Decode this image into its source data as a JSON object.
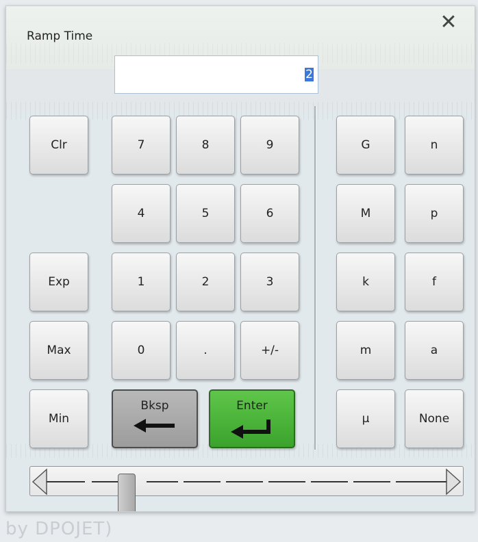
{
  "dialog": {
    "title": "Ramp Time",
    "close_glyph": "✕",
    "value": "2"
  },
  "keys": {
    "clr": "Clr",
    "exp": "Exp",
    "max": "Max",
    "min": "Min",
    "n7": "7",
    "n8": "8",
    "n9": "9",
    "n4": "4",
    "n5": "5",
    "n6": "6",
    "n1": "1",
    "n2": "2",
    "n3": "3",
    "n0": "0",
    "dot": ".",
    "plusminus": "+/-",
    "bksp": "Bksp",
    "enter": "Enter"
  },
  "units": {
    "G": "G",
    "n": "n",
    "M": "M",
    "p": "p",
    "k": "k",
    "f": "f",
    "m": "m",
    "a": "a",
    "mu": "μ",
    "none": "None"
  },
  "slider": {
    "value_fraction": 0.2
  },
  "background": {
    "partial_text": "by DPOJET)"
  },
  "colors": {
    "enter_green": "#3ba32c",
    "bksp_gray": "#9c9c9c",
    "selection_blue": "#3b78d8"
  }
}
